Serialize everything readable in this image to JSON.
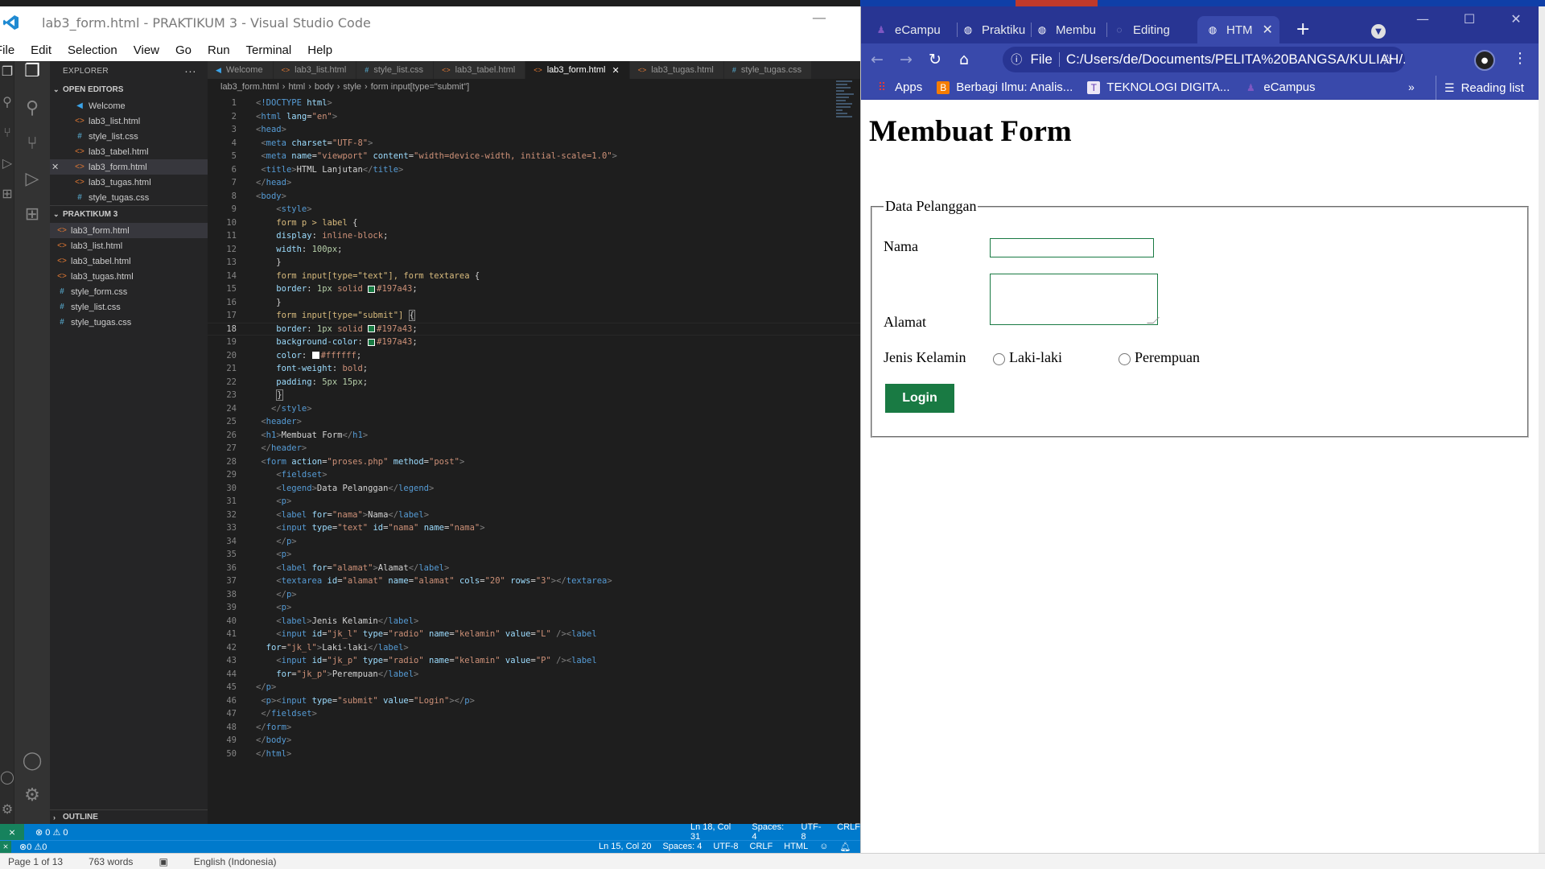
{
  "vscode": {
    "title": "lab3_form.html - PRAKTIKUM 3 - Visual Studio Code",
    "menu": [
      "File",
      "Edit",
      "Selection",
      "View",
      "Go",
      "Run",
      "Terminal",
      "Help"
    ],
    "explorer_label": "EXPLORER",
    "open_editors_label": "OPEN EDITORS",
    "open_editors": [
      {
        "name": "Welcome",
        "icon": "vscode-icon"
      },
      {
        "name": "lab3_list.html",
        "icon": "html-file-icon"
      },
      {
        "name": "style_list.css",
        "icon": "css-file-icon"
      },
      {
        "name": "lab3_tabel.html",
        "icon": "html-file-icon"
      },
      {
        "name": "lab3_form.html",
        "icon": "html-file-icon"
      },
      {
        "name": "lab3_tugas.html",
        "icon": "html-file-icon"
      },
      {
        "name": "style_tugas.css",
        "icon": "css-file-icon"
      }
    ],
    "folder_label": "PRAKTIKUM 3",
    "folder_files": [
      {
        "name": "lab3_form.html",
        "icon": "html-file-icon"
      },
      {
        "name": "lab3_list.html",
        "icon": "html-file-icon"
      },
      {
        "name": "lab3_tabel.html",
        "icon": "html-file-icon"
      },
      {
        "name": "lab3_tugas.html",
        "icon": "html-file-icon"
      },
      {
        "name": "style_form.css",
        "icon": "css-file-icon"
      },
      {
        "name": "style_list.css",
        "icon": "css-file-icon"
      },
      {
        "name": "style_tugas.css",
        "icon": "css-file-icon"
      }
    ],
    "outline_label": "OUTLINE",
    "tabs": [
      "Welcome",
      "lab3_list.html",
      "style_list.css",
      "lab3_tabel.html",
      "lab3_form.html",
      "lab3_tugas.html",
      "style_tugas.css"
    ],
    "active_tab": "lab3_form.html",
    "breadcrumb": [
      "lab3_form.html",
      "html",
      "body",
      "style",
      "form input[type=\"submit\"]"
    ],
    "current_line": 18,
    "color_swatches": {
      "green": "#197a43",
      "white": "#ffffff"
    },
    "status": {
      "errors": "0",
      "warnings": "0",
      "position": "Ln 18, Col 31",
      "spaces": "Spaces: 4",
      "encoding": "UTF-8",
      "eol": "CRLF",
      "status2_errors": "0",
      "status2_warnings": "0",
      "status2_position": "Ln 15, Col 20",
      "status2_spaces": "Spaces: 4",
      "status2_encoding": "UTF-8",
      "status2_eol": "CRLF",
      "status2_lang": "HTML"
    }
  },
  "word": {
    "page": "Page 1 of 13",
    "words": "763 words",
    "language": "English (Indonesia)"
  },
  "chrome": {
    "tabs": [
      {
        "label": "eCampu",
        "active": false
      },
      {
        "label": "Praktiku",
        "active": false
      },
      {
        "label": "Membu",
        "active": false
      },
      {
        "label": "Editing",
        "active": false
      },
      {
        "label": "HTM",
        "active": true
      }
    ],
    "file_label": "File",
    "url": "C:/Users/de/Documents/PELITA%20BANGSA/KULIAH/...",
    "bookmarks": [
      "Apps",
      "Berbagi Ilmu: Analis...",
      "TEKNOLOGI DIGITA...",
      "eCampus"
    ],
    "more": "»",
    "reading_list": "Reading list",
    "theme_color": "#3949ab"
  },
  "page": {
    "h1": "Membuat Form",
    "legend": "Data Pelanggan",
    "nama_label": "Nama",
    "alamat_label": "Alamat",
    "jk_label": "Jenis Kelamin",
    "radio_l": "Laki-laki",
    "radio_p": "Perempuan",
    "submit": "Login"
  }
}
